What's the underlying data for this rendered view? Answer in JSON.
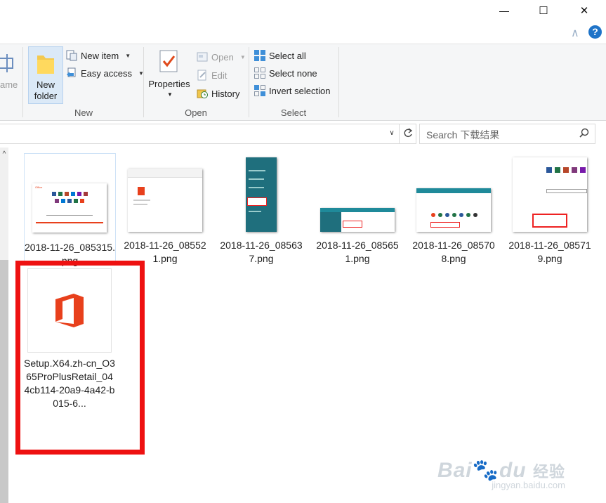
{
  "window": {
    "minimize_glyph": "—",
    "maximize_glyph": "☐",
    "close_glyph": "✕",
    "help_glyph": "?",
    "collapse_glyph": "∧"
  },
  "ribbon": {
    "clipped_label": "ame",
    "new_group": {
      "new_folder_line1": "New",
      "new_folder_line2": "folder",
      "new_item": "New item",
      "easy_access": "Easy access",
      "label": "New"
    },
    "open_group": {
      "properties": "Properties",
      "open": "Open",
      "edit": "Edit",
      "history": "History",
      "label": "Open"
    },
    "select_group": {
      "select_all": "Select all",
      "select_none": "Select none",
      "invert_selection": "Invert selection",
      "label": "Select"
    }
  },
  "search": {
    "placeholder": "Search 下载结果"
  },
  "files": [
    {
      "name": "2018-11-26_085315.png"
    },
    {
      "name": "2018-11-26_085521.png"
    },
    {
      "name": "2018-11-26_085637.png"
    },
    {
      "name": "2018-11-26_085651.png"
    },
    {
      "name": "2018-11-26_085708.png"
    },
    {
      "name": "2018-11-26_085719.png"
    },
    {
      "name": "Setup.X64.zh-cn_O365ProPlusRetail_044cb114-20a9-4a42-b015-6..."
    }
  ],
  "watermark": {
    "brand": "Bai",
    "brand2": "du",
    "chinese": "经验",
    "url": "jingyan.baidu.com"
  },
  "colors": {
    "highlight": "#ee1111",
    "office_orange": "#e8401c",
    "accent": "#1e73c8"
  }
}
